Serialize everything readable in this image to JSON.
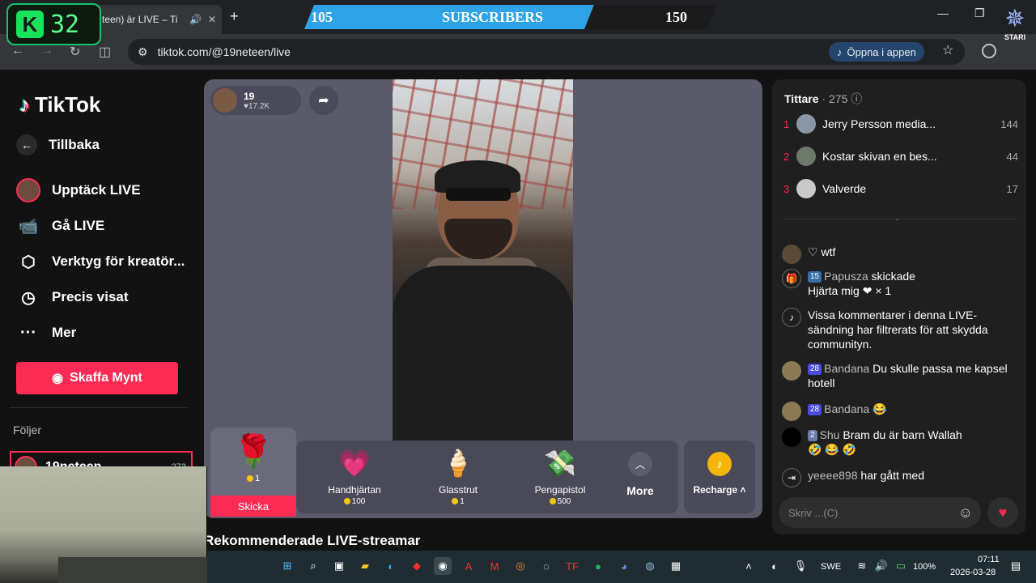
{
  "browser": {
    "tab_title": "teen) är LIVE – Ti",
    "url": "tiktok.com/@19neteen/live",
    "open_app_label": "Öppna i appen"
  },
  "overlay": {
    "k_number": "32",
    "sub_left": "105",
    "sub_label": "SUBSCRIBERS",
    "sub_right": "150",
    "stari_label": "STARI"
  },
  "sidebar": {
    "logo": "TikTok",
    "back": "Tillbaka",
    "items": [
      {
        "label": "Upptäck LIVE"
      },
      {
        "label": "Gå LIVE"
      },
      {
        "label": "Verktyg för kreatör..."
      },
      {
        "label": "Precis visat"
      },
      {
        "label": "Mer"
      }
    ],
    "coin_button": "Skaffa Mynt",
    "follows_title": "Följer",
    "follow_item": {
      "name": "19neteen",
      "count": "273"
    }
  },
  "stage": {
    "host_name": "19",
    "host_likes": "17.2K",
    "gifts": [
      {
        "name": "Handhjärtan",
        "price": "100",
        "icon": "heart-hands-icon"
      },
      {
        "name": "Glasstrut",
        "price": "1",
        "icon": "ice-cream-icon"
      },
      {
        "name": "Pengapistol",
        "price": "500",
        "icon": "money-gun-icon"
      }
    ],
    "selected_gift": {
      "price": "1",
      "send": "Skicka",
      "icon": "rose-icon"
    },
    "more_label": "More",
    "recharge_label": "Recharge",
    "recommended": "Rekommenderade LIVE-streamar"
  },
  "viewers": {
    "title": "Tittare",
    "count": "275",
    "list": [
      {
        "rank": "1",
        "name": "Jerry Persson media...",
        "score": "144"
      },
      {
        "rank": "2",
        "name": "Kostar skivan en bes...",
        "score": "44"
      },
      {
        "rank": "3",
        "name": "Valverde",
        "score": "17"
      }
    ]
  },
  "chat": [
    {
      "user": "",
      "badge": "",
      "text": "wtf"
    },
    {
      "user": "Papusza",
      "badge": "15",
      "text": "skickade",
      "extra": "Hjärta mig",
      "multiplier": "× 1"
    },
    {
      "user": "",
      "badge": "",
      "text": "Vissa kommentarer i denna LIVE-sändning har filtrerats för att skydda communityn."
    },
    {
      "user": "Bandana",
      "badge": "28",
      "text": "Du skulle passa me kapsel hotell"
    },
    {
      "user": "Bandana",
      "badge": "28",
      "text": "😂"
    },
    {
      "user": "Shu",
      "badge": "2",
      "text": "Bram du är barn Wallah",
      "extra": "🤣 😂 🤣"
    },
    {
      "user": "yeeee898",
      "badge": "",
      "text": "har gått med"
    }
  ],
  "chat_input_placeholder": "Skriv ...(C)",
  "taskbar": {
    "lang": "SWE",
    "battery": "100%",
    "time": "07:11",
    "date": "2026-03-28"
  }
}
